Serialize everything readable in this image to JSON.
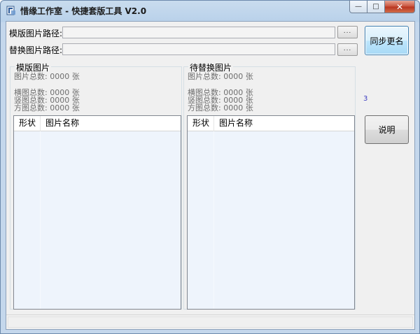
{
  "window": {
    "title": "惜缘工作室 - 快捷套版工具 V2.0",
    "minimize_glyph": "—",
    "maximize_glyph": "□",
    "close_glyph": "✕"
  },
  "paths": {
    "template_label": "模版图片路径:",
    "template_value": "",
    "replace_label": "替换图片路径:",
    "replace_value": "",
    "browse_label": "..."
  },
  "buttons": {
    "sync_rename": "同步更名",
    "help": "说明"
  },
  "template_group": {
    "title": "模版图片",
    "total": "图片总数: 0000  张",
    "landscape": "横图总数: 0000  张",
    "portrait": "竖图总数: 0000  张",
    "square": "方图总数: 0000  张",
    "columns": [
      "形状",
      "图片名称"
    ]
  },
  "replace_group": {
    "title": "待替换图片",
    "total": "图片总数: 0000  张",
    "landscape": "横图总数: 0000  张",
    "portrait": "竖图总数: 0000  张",
    "square": "方图总数: 0000  张",
    "columns": [
      "形状",
      "图片名称"
    ]
  },
  "stray_mark": "3",
  "icons": {
    "app": "app-icon",
    "minimize": "minimize-icon",
    "maximize": "maximize-icon",
    "close": "close-icon"
  },
  "colors": {
    "list_bg": "#eef4fc",
    "title_gradient": "#b9d1ea",
    "close_red": "#c7503a"
  }
}
